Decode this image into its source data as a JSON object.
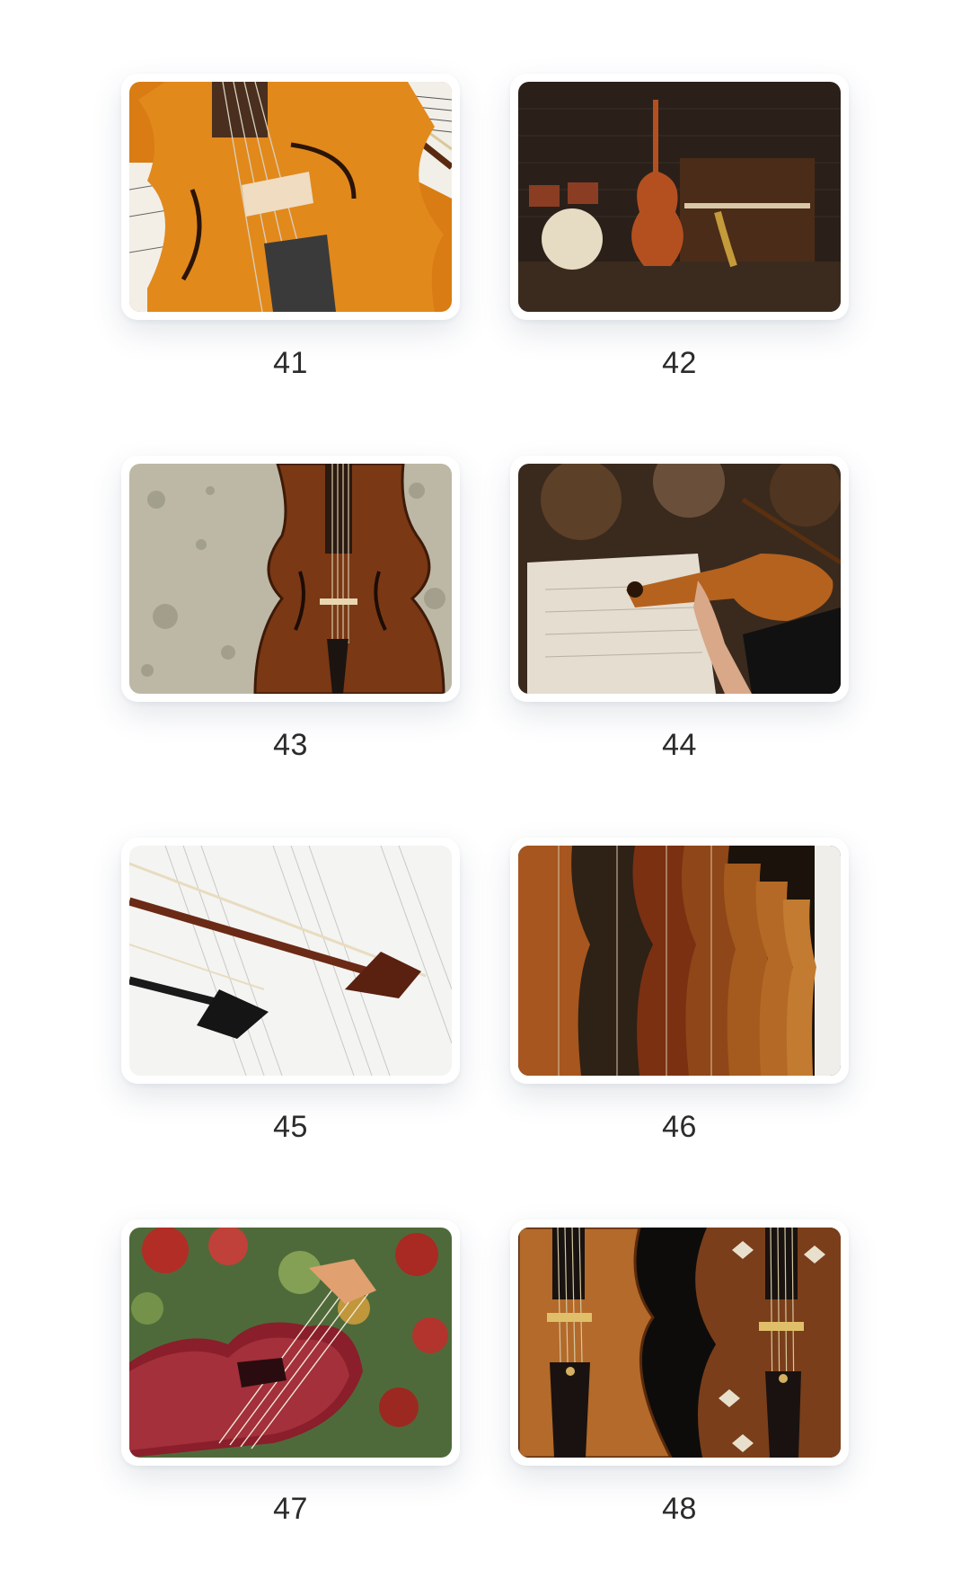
{
  "gallery": {
    "items": [
      {
        "number": "41",
        "image": "violet-closeup-with-sheet-music"
      },
      {
        "number": "42",
        "image": "drums-double-bass-piano-saxophone"
      },
      {
        "number": "43",
        "image": "antique-violin-on-grunge-wall"
      },
      {
        "number": "44",
        "image": "violinist-playing-in-orchestra"
      },
      {
        "number": "45",
        "image": "violin-bows-on-sheet-music"
      },
      {
        "number": "46",
        "image": "row-of-hanging-violins"
      },
      {
        "number": "47",
        "image": "red-violin-in-rose-garden"
      },
      {
        "number": "48",
        "image": "two-ornate-violins"
      }
    ]
  },
  "colors": {
    "background": "#ffffff",
    "label": "#2b2b2b"
  }
}
